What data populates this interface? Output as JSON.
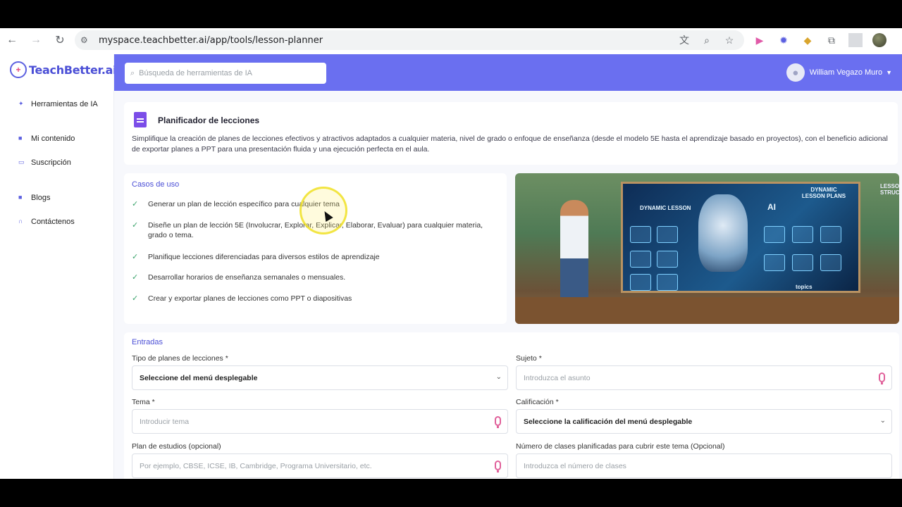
{
  "browser": {
    "url": "myspace.teachbetter.ai/app/tools/lesson-planner",
    "back_icon": "arrow-left-icon",
    "forward_icon": "arrow-right-icon",
    "reload_icon": "reload-icon"
  },
  "sidebar": {
    "logo_text": "TeachBetter.ai",
    "items": [
      {
        "label": "Herramientas de IA",
        "icon": "sparkle-icon"
      },
      {
        "label": "Mi contenido",
        "icon": "document-icon"
      },
      {
        "label": "Suscripción",
        "icon": "card-icon"
      },
      {
        "label": "Blogs",
        "icon": "blog-icon"
      },
      {
        "label": "Contáctenos",
        "icon": "headset-icon"
      }
    ]
  },
  "header": {
    "search_placeholder": "Búsqueda de herramientas de IA",
    "user_name": "William Vegazo Muro",
    "accent": "#6a6ff0"
  },
  "tool": {
    "title": "Planificador de lecciones",
    "description": "Simplifique la creación de planes de lecciones efectivos y atractivos adaptados a cualquier materia, nivel de grado o enfoque de enseñanza (desde el modelo 5E hasta el aprendizaje basado en proyectos), con el beneficio adicional de exportar planes a PPT para una presentación fluida y una ejecución perfecta en el aula."
  },
  "use_cases": {
    "title": "Casos de uso",
    "items": [
      "Generar un plan de lección específico para cualquier tema",
      "Diseñe un plan de lección 5E (Involucrar, Explorar, Explicar, Elaborar, Evaluar) para cualquier materia, grado o tema.",
      "Planifique lecciones diferenciadas para diversos estilos de aprendizaje",
      "Desarrollar horarios de enseñanza semanales o mensuales.",
      "Crear y exportar planes de lecciones como PPT o diapositivas"
    ]
  },
  "hero": {
    "board_title": "DYNAMIC LESSON PLANS",
    "side_label": "LESSON STRUCT",
    "center_label": "DYNAMIC LESSON",
    "ai_label": "AI",
    "topics_label": "topics"
  },
  "inputs": {
    "title": "Entradas",
    "lesson_type": {
      "label": "Tipo de planes de lecciones *",
      "value": "Seleccione del menú desplegable"
    },
    "subject": {
      "label": "Sujeto *",
      "placeholder": "Introduzca el asunto"
    },
    "topic": {
      "label": "Tema *",
      "placeholder": "Introducir tema"
    },
    "grade": {
      "label": "Calificación *",
      "value": "Seleccione la calificación del menú desplegable"
    },
    "curriculum": {
      "label": "Plan de estudios (opcional)",
      "placeholder": "Por ejemplo, CBSE, ICSE, IB, Cambridge, Programa Universitario, etc."
    },
    "classes": {
      "label": "Número de clases planificadas para cubrir este tema (Opcional)",
      "placeholder": "Introduzca el número de clases"
    }
  }
}
